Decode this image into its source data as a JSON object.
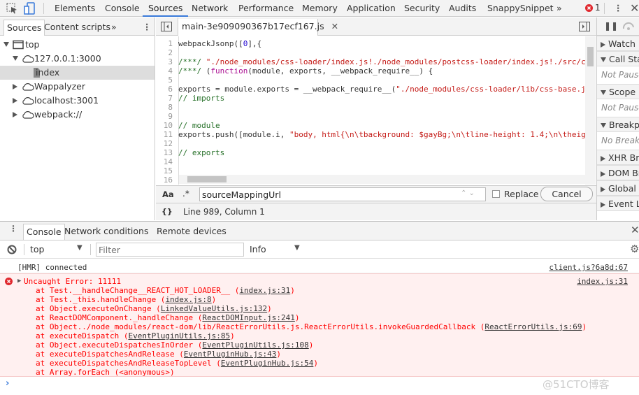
{
  "toolbar": {
    "tabs": [
      "Elements",
      "Console",
      "Sources",
      "Network",
      "Performance",
      "Memory",
      "Application",
      "Security",
      "Audits",
      "SnappySnippet"
    ],
    "active_tab": "Sources",
    "more": "»",
    "error_count": "1"
  },
  "navigator": {
    "tabs": [
      "Sources",
      "Content scripts"
    ],
    "more": "»",
    "tree": [
      {
        "label": "top",
        "icon": "frame-icon",
        "expanded": true
      },
      {
        "label": "127.0.0.1:3000",
        "icon": "cloud-icon",
        "expanded": true
      },
      {
        "label": "index",
        "icon": "file-icon",
        "selected": true
      },
      {
        "label": "Wappalyzer",
        "icon": "cloud-icon",
        "expanded": false
      },
      {
        "label": "localhost:3001",
        "icon": "cloud-icon",
        "expanded": false
      },
      {
        "label": "webpack://",
        "icon": "cloud-icon",
        "expanded": false
      }
    ]
  },
  "editor": {
    "file_tab": "main-3e909090367b17ecf167.js",
    "lines": [
      [
        [
          "",
          "webpackJsonp(["
        ],
        [
          "nm",
          "0"
        ],
        [
          "",
          "],{"
        ]
      ],
      [],
      [
        [
          "cm",
          "/***/ "
        ],
        [
          "st",
          "\"./node_modules/css-loader/index.js!./node_modules/postcss-loader/index.js!./src/c"
        ]
      ],
      [
        [
          "cm",
          "/***/ "
        ],
        [
          "",
          "("
        ],
        [
          "kw",
          "function"
        ],
        [
          "",
          "(module, exports, __webpack_require__) {"
        ]
      ],
      [],
      [
        [
          "",
          "exports = module.exports = __webpack_require__("
        ],
        [
          "st",
          "\"./node_modules/css-loader/lib/css-base.js"
        ]
      ],
      [
        [
          "cm",
          "// imports"
        ]
      ],
      [],
      [],
      [
        [
          "cm",
          "// module"
        ]
      ],
      [
        [
          "",
          "exports.push([module.i, "
        ],
        [
          "st",
          "\"body, html{\\n\\tbackground: $gayBg;\\n\\tline-height: 1.4;\\n\\theig"
        ]
      ],
      [],
      [
        [
          "cm",
          "// exports"
        ]
      ],
      [],
      [],
      []
    ],
    "search": {
      "match_case": "Aa",
      "regex": ".*",
      "value": "sourceMappingUrl",
      "replace_label": "Replace",
      "cancel_label": "Cancel"
    },
    "status": {
      "format_icon": "{}",
      "position": "Line 989, Column 1"
    }
  },
  "debugger_sidebar": {
    "sections": [
      {
        "label": "Watch",
        "expanded": false
      },
      {
        "label": "Call Stack",
        "expanded": true,
        "body": "Not Paused"
      },
      {
        "label": "Scope",
        "expanded": true,
        "body": "Not Paused"
      },
      {
        "label": "Breakpoints",
        "expanded": true,
        "body": "No Breakpoints"
      },
      {
        "label": "XHR Breakpoints",
        "expanded": false
      },
      {
        "label": "DOM Breakpoints",
        "expanded": false
      },
      {
        "label": "Global Listeners",
        "expanded": false
      },
      {
        "label": "Event Listener Breakpoints",
        "expanded": false
      }
    ]
  },
  "drawer": {
    "tabs": [
      "Console",
      "Network conditions",
      "Remote devices"
    ],
    "active_tab": "Console",
    "context": "top",
    "filter_placeholder": "Filter",
    "level": "Info"
  },
  "console": {
    "messages": [
      {
        "text": "[HMR] connected",
        "source": "client.js?6a8d:67"
      }
    ],
    "error": {
      "text": "Uncaught Error: 11111",
      "source": "index.js:31",
      "stack": [
        {
          "pre": "at Test.__handleChange__REACT_HOT_LOADER__ (",
          "link": "index.js:31",
          "post": ")"
        },
        {
          "pre": "at Test._this.handleChange (",
          "link": "index.js:8",
          "post": ")"
        },
        {
          "pre": "at Object.executeOnChange (",
          "link": "LinkedValueUtils.js:132",
          "post": ")"
        },
        {
          "pre": "at ReactDOMComponent._handleChange (",
          "link": "ReactDOMInput.js:241",
          "post": ")"
        },
        {
          "pre": "at Object../node_modules/react-dom/lib/ReactErrorUtils.js.ReactErrorUtils.invokeGuardedCallback (",
          "link": "ReactErrorUtils.js:69",
          "post": ")"
        },
        {
          "pre": "at executeDispatch (",
          "link": "EventPluginUtils.js:85",
          "post": ")"
        },
        {
          "pre": "at Object.executeDispatchesInOrder (",
          "link": "EventPluginUtils.js:108",
          "post": ")"
        },
        {
          "pre": "at executeDispatchesAndRelease (",
          "link": "EventPluginHub.js:43",
          "post": ")"
        },
        {
          "pre": "at executeDispatchesAndReleaseTopLevel (",
          "link": "EventPluginHub.js:54",
          "post": ")"
        },
        {
          "pre": "at Array.forEach (<anonymous>)",
          "link": "",
          "post": ""
        }
      ]
    },
    "prompt": "›"
  },
  "watermark": "@51CTO博客"
}
